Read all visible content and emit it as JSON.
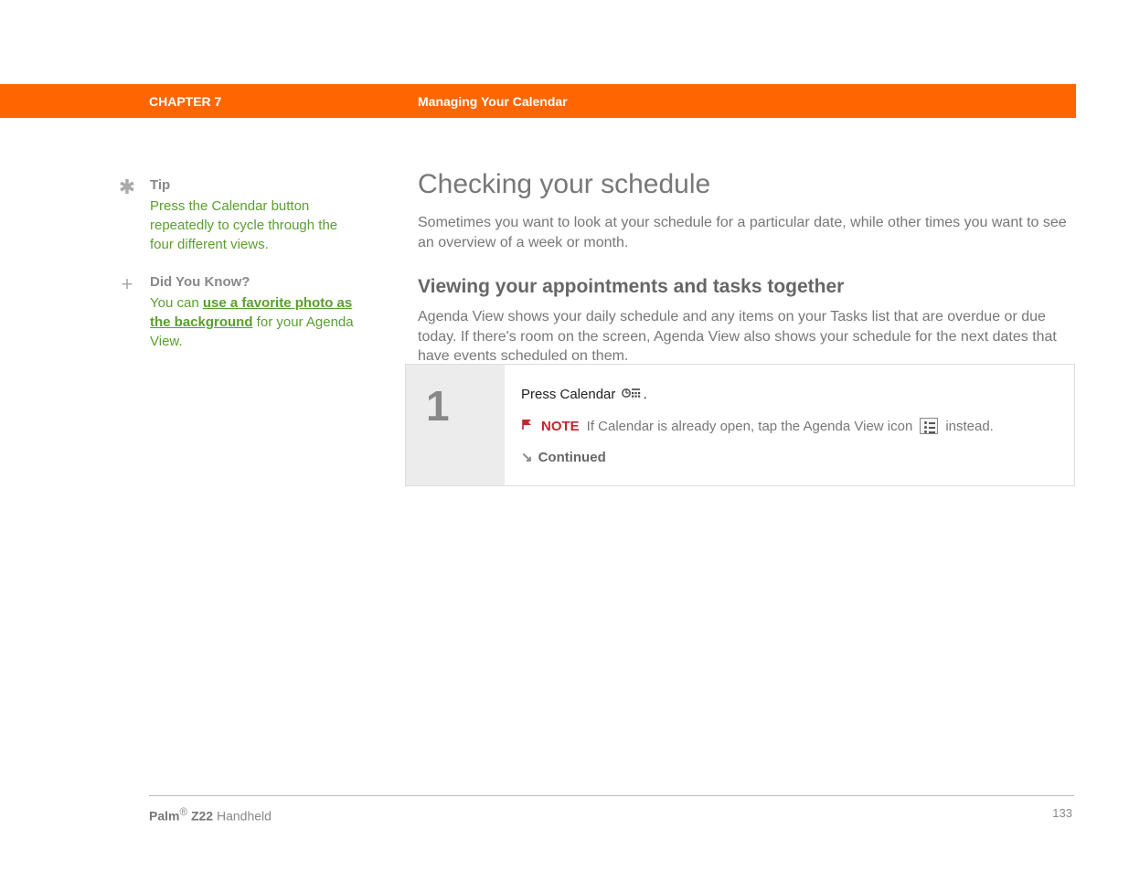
{
  "header": {
    "chapter": "CHAPTER 7",
    "title": "Managing Your Calendar"
  },
  "sidebar": {
    "tip": {
      "heading": "Tip",
      "body": "Press the Calendar button repeatedly to cycle through the four different views."
    },
    "dyk": {
      "heading": "Did You Know?",
      "prefix": "You can ",
      "link": "use a favorite photo as the background",
      "suffix": " for your Agenda View."
    }
  },
  "main": {
    "h1": "Checking your schedule",
    "intro": "Sometimes you want to look at your schedule for a particular date, while other times you want to see an overview of a week or month.",
    "h2": "Viewing your appointments and tasks together",
    "para": "Agenda View shows your daily schedule and any items on your Tasks list that are overdue or due today. If there's room on the screen, Agenda View also shows your schedule for the next dates that have events scheduled on them."
  },
  "step": {
    "number": "1",
    "line1_prefix": "Press Calendar ",
    "line1_suffix": ".",
    "note_label": "NOTE",
    "note_prefix": "If Calendar is already open, tap the Agenda View icon ",
    "note_suffix": " instead.",
    "continued": "Continued"
  },
  "footer": {
    "product_bold": "Palm",
    "product_reg": "®",
    "product_model": " Z22 ",
    "product_tail": "Handheld",
    "page": "133"
  }
}
